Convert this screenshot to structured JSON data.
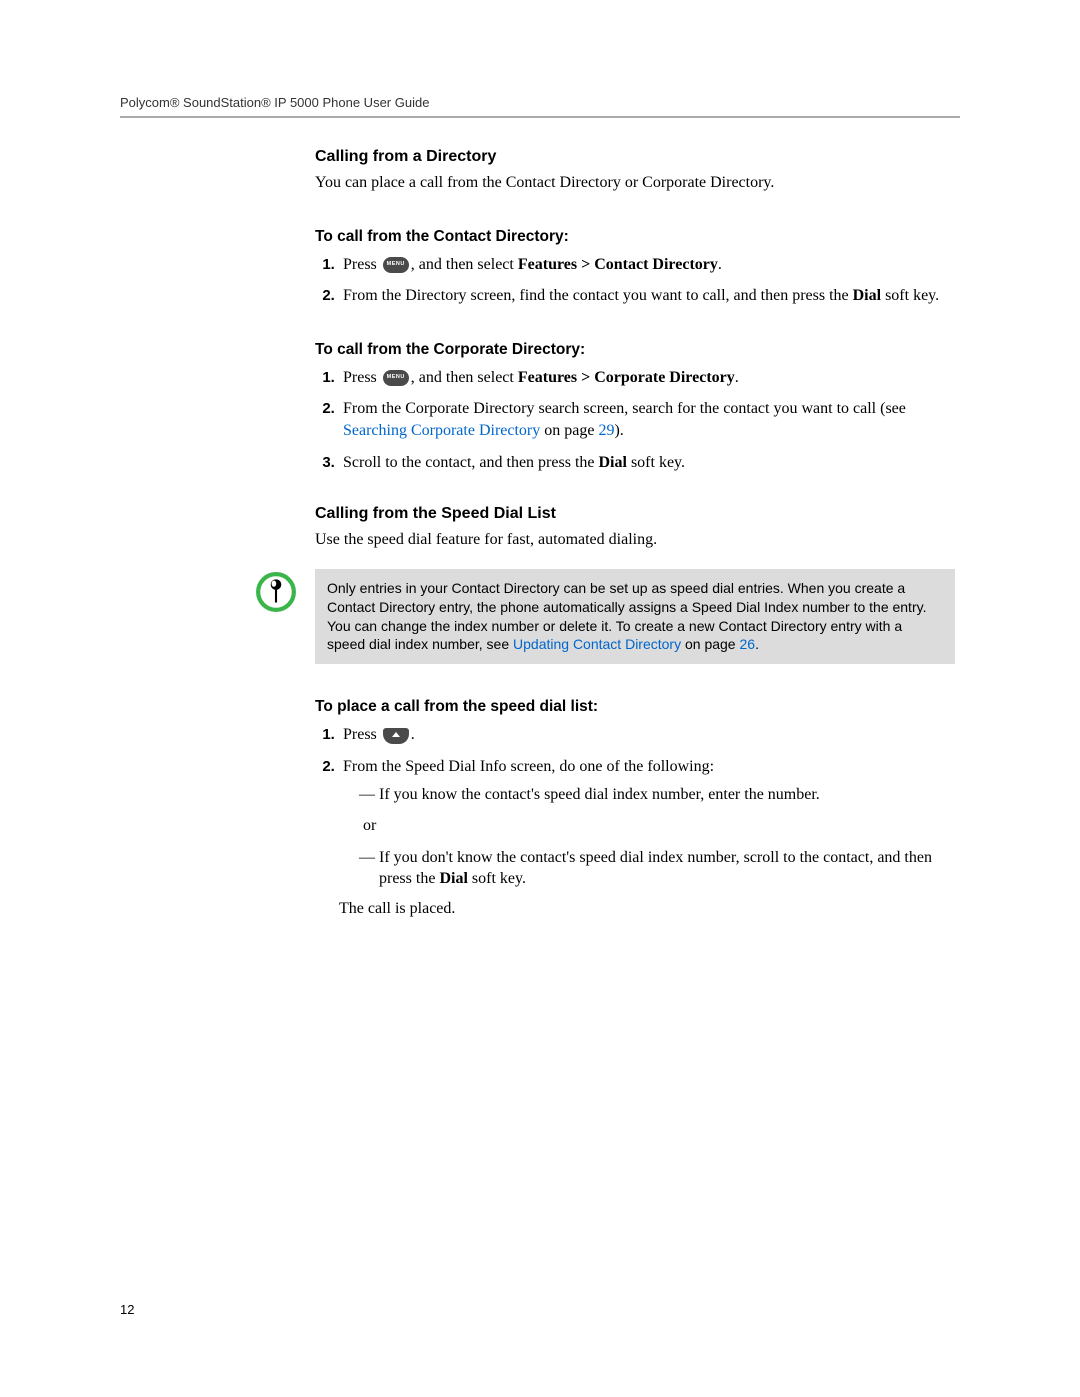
{
  "header": {
    "title": "Polycom® SoundStation® IP 5000 Phone User Guide"
  },
  "sections": {
    "dir": {
      "heading": "Calling from a Directory",
      "intro": "You can place a call from the Contact Directory or Corporate Directory."
    },
    "contact": {
      "heading": "To call from the Contact Directory:",
      "steps": {
        "s1_a": "Press ",
        "s1_b": ", and then select ",
        "s1_bold": "Features > Contact Directory",
        "s1_c": ".",
        "s2_a": "From the Directory screen, find the contact you want to call, and then press the ",
        "s2_bold": "Dial",
        "s2_b": " soft key."
      }
    },
    "corporate": {
      "heading": "To call from the Corporate Directory:",
      "steps": {
        "s1_a": "Press ",
        "s1_b": ", and then select ",
        "s1_bold": "Features > Corporate Directory",
        "s1_c": ".",
        "s2_a": "From the Corporate Directory search screen, search for the contact you want to call (see ",
        "s2_link": "Searching Corporate Directory",
        "s2_b": " on page ",
        "s2_pg": "29",
        "s2_c": ").",
        "s3_a": "Scroll to the contact, and then press the ",
        "s3_bold": "Dial",
        "s3_b": " soft key."
      }
    },
    "speed": {
      "heading": "Calling from the Speed Dial List",
      "intro": "Use the speed dial feature for fast, automated dialing.",
      "note_a": "Only entries in your Contact Directory can be set up as speed dial entries. When you create a Contact Directory entry, the phone automatically assigns a Speed Dial Index number to the entry. You can change the index number or delete it. To create a new Contact Directory entry with a speed dial index number, see ",
      "note_link": "Updating Contact Directory",
      "note_b": " on page ",
      "note_pg": "26",
      "note_c": "."
    },
    "place": {
      "heading": "To place a call from the speed dial list:",
      "s1_a": "Press ",
      "s1_b": ".",
      "s2": "From the Speed Dial Info screen, do one of the following:",
      "li1": "If you know the contact's speed dial index number, enter the number.",
      "or": "or",
      "li2_a": "If you don't know the contact's speed dial index number, scroll to the contact, and then press the ",
      "li2_bold": "Dial",
      "li2_b": " soft key.",
      "closing": "The call is placed."
    }
  },
  "icons": {
    "menu_label": "MENU"
  },
  "page_number": "12"
}
